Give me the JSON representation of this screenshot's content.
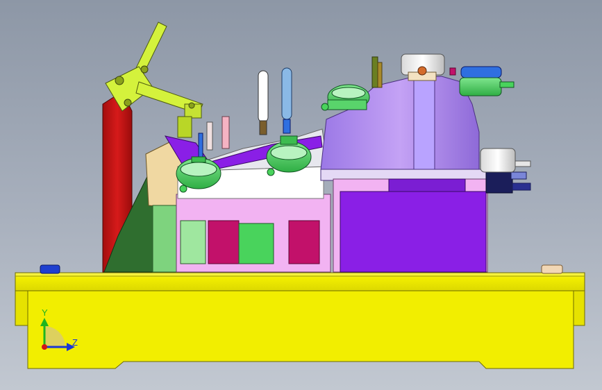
{
  "viewport": {
    "background_top": "#8d97a6",
    "background_bottom": "#c2c8d1"
  },
  "triad": {
    "y_label": "Y",
    "z_label": "Z",
    "y_color": "#1fb51f",
    "z_color": "#1a37d6",
    "x_color": "#d01616"
  },
  "model": {
    "colors": {
      "base": "#f2ee00",
      "clamp": "#d4f23c",
      "post": "#c41414",
      "housing": "#b98ef0",
      "block": "#8a1fe6",
      "gauge_green": "#49d35c",
      "gauge_blue": "#2f6fe0",
      "pink": "#f2b3f2",
      "magenta": "#c2116a"
    }
  }
}
